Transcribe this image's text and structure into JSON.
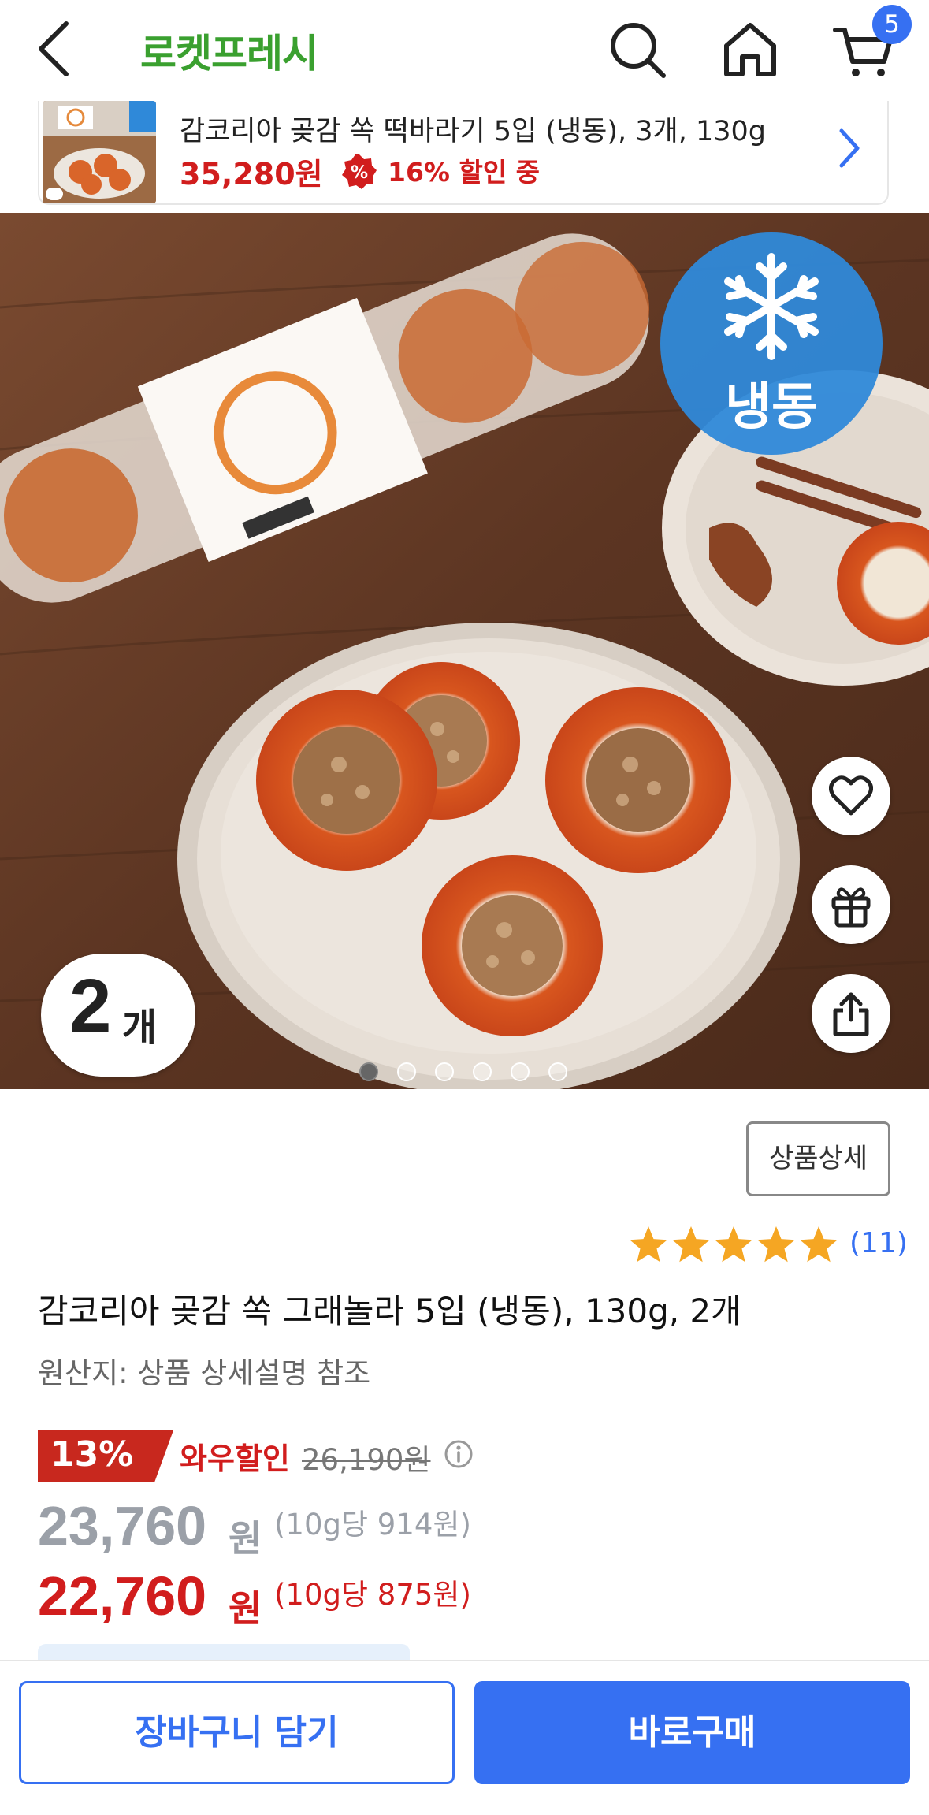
{
  "nav": {
    "brand": "로켓프레시",
    "cart_count": "5",
    "icons": [
      "back-arrow-icon",
      "search-icon",
      "home-icon",
      "cart-icon"
    ]
  },
  "banner": {
    "title": "감코리아 곶감 쏙 떡바라기 5입 (냉동), 3개, 130g",
    "price": "35,280원",
    "discount": "16% 할인 중",
    "percent_badge": "%"
  },
  "hero": {
    "frozen_label": "냉동",
    "count_number": "2",
    "count_unit": "개",
    "image_count": 6,
    "active_image": 1
  },
  "info": {
    "detail_button": "상품상세",
    "rating_stars": 5,
    "review_count": "(11)",
    "title": "감코리아 곶감 쏙 그래놀라 5입 (냉동), 130g, 2개",
    "origin": "원산지: 상품 상세설명 참조"
  },
  "pricing": {
    "discount_percent": "13%",
    "wow_label": "와우할인",
    "original_price": "26,190원",
    "price": "23,760",
    "price_currency": "원",
    "price_unit": "(10g당 914원)",
    "wow_price": "22,760",
    "wow_currency": "원",
    "wow_unit": "(10g당 875원)"
  },
  "actions": {
    "add_to_cart": "장바구니 담기",
    "buy_now": "바로구매"
  },
  "colors": {
    "brand_green": "#3aa02f",
    "accent_blue": "#3670f2",
    "discount_red": "#d11d1d",
    "frozen_blue": "#2f89d9"
  }
}
